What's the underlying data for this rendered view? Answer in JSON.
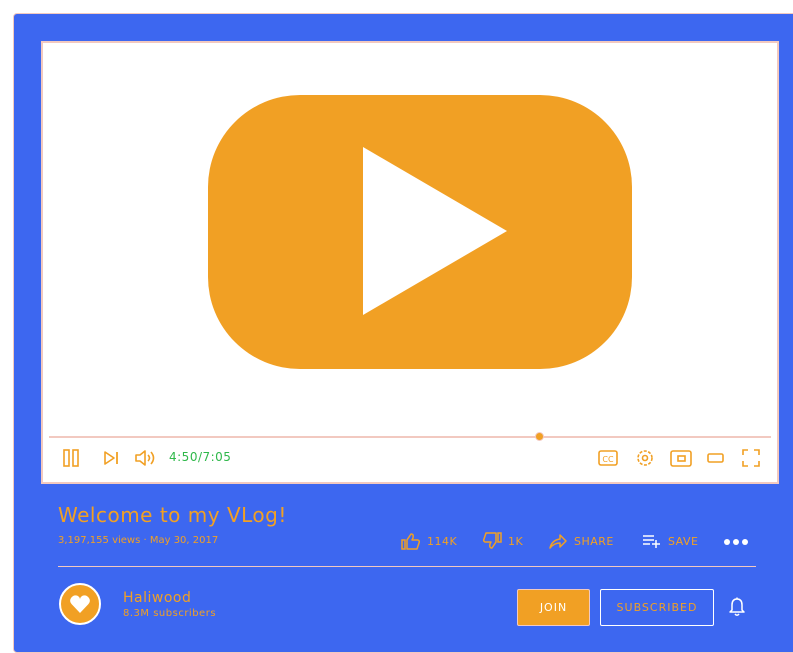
{
  "video": {
    "current_time": "4:50",
    "duration": "7:05",
    "time_display": "4:50/7:05",
    "progress": 0.679
  },
  "controls": {
    "icons": [
      "pause-icon",
      "next-icon",
      "volume-icon",
      "captions-icon",
      "settings-icon",
      "miniplayer-icon",
      "theater-icon",
      "fullscreen-icon"
    ],
    "captions_label": "CC"
  },
  "info": {
    "title": "Welcome to my VLog!",
    "meta": "3,197,155 views · May 30, 2017"
  },
  "actions": {
    "likes": "114K",
    "dislikes": "1K",
    "share": "SHARE",
    "save": "SAVE"
  },
  "channel": {
    "name": "Haliwood",
    "subscribers": "8.3M subscribers",
    "join_label": "JOIN",
    "subscribed_label": "SUBSCRIBED"
  },
  "colors": {
    "background": "#3d67f0",
    "accent": "#f1a024",
    "outline": "#f2c9c0",
    "time_text": "#2fb84a",
    "player_bg": "#ffffff"
  }
}
